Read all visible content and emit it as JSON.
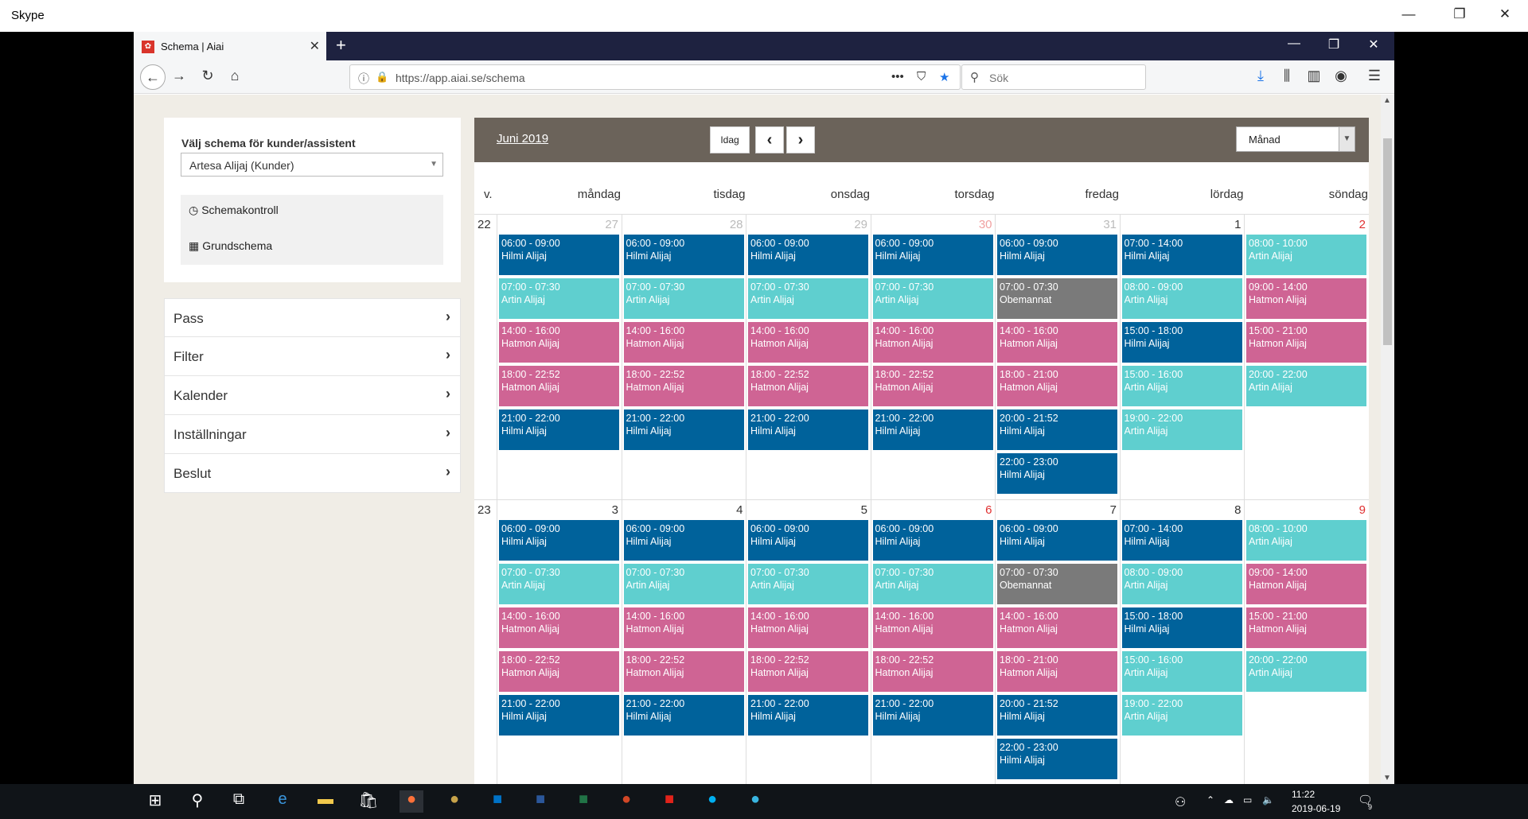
{
  "skype": {
    "title": "Skype",
    "min": "—",
    "max": "❐",
    "close": "✕"
  },
  "browser": {
    "tab_title": "Schema | Aiai",
    "tab_close": "✕",
    "new_tab": "+",
    "url": "https://app.aiai.se/schema",
    "url_actions": "•••",
    "search_placeholder": "Sök",
    "win_min": "—",
    "win_max": "❐",
    "win_close": "✕"
  },
  "left": {
    "label": "Välj schema för kunder/assistent",
    "select_value": "Artesa Alijaj (Kunder)",
    "links": [
      "Schemakontroll",
      "Grundschema"
    ],
    "accordion": [
      "Pass",
      "Filter",
      "Kalender",
      "Inställningar",
      "Beslut"
    ]
  },
  "calendar": {
    "month": "Juni 2019",
    "today": "Idag",
    "prev": "‹",
    "next": "›",
    "view": "Månad",
    "week_header": "v.",
    "days": [
      "måndag",
      "tisdag",
      "onsdag",
      "torsdag",
      "fredag",
      "lördag",
      "söndag"
    ],
    "colors": {
      "dark": "#00629b",
      "light": "#5fcfcf",
      "pink": "#cf6494",
      "gray": "#7a7a7a"
    },
    "weeks": [
      {
        "num": "22",
        "dates": [
          {
            "d": "27",
            "other": true
          },
          {
            "d": "28",
            "other": true
          },
          {
            "d": "29",
            "other": true
          },
          {
            "d": "30",
            "other": true,
            "red": true
          },
          {
            "d": "31",
            "other": true
          },
          {
            "d": "1"
          },
          {
            "d": "2",
            "red": true
          }
        ],
        "events": [
          [
            [
              "06:00 - 09:00",
              "Hilmi Alijaj",
              "dark"
            ],
            [
              "07:00 - 07:30",
              "Artin Alijaj",
              "light"
            ],
            [
              "14:00 - 16:00",
              "Hatmon Alijaj",
              "pink"
            ],
            [
              "18:00 - 22:52",
              "Hatmon Alijaj",
              "pink"
            ],
            [
              "21:00 - 22:00",
              "Hilmi Alijaj",
              "dark"
            ]
          ],
          [
            [
              "06:00 - 09:00",
              "Hilmi Alijaj",
              "dark"
            ],
            [
              "07:00 - 07:30",
              "Artin Alijaj",
              "light"
            ],
            [
              "14:00 - 16:00",
              "Hatmon Alijaj",
              "pink"
            ],
            [
              "18:00 - 22:52",
              "Hatmon Alijaj",
              "pink"
            ],
            [
              "21:00 - 22:00",
              "Hilmi Alijaj",
              "dark"
            ]
          ],
          [
            [
              "06:00 - 09:00",
              "Hilmi Alijaj",
              "dark"
            ],
            [
              "07:00 - 07:30",
              "Artin Alijaj",
              "light"
            ],
            [
              "14:00 - 16:00",
              "Hatmon Alijaj",
              "pink"
            ],
            [
              "18:00 - 22:52",
              "Hatmon Alijaj",
              "pink"
            ],
            [
              "21:00 - 22:00",
              "Hilmi Alijaj",
              "dark"
            ]
          ],
          [
            [
              "06:00 - 09:00",
              "Hilmi Alijaj",
              "dark"
            ],
            [
              "07:00 - 07:30",
              "Artin Alijaj",
              "light"
            ],
            [
              "14:00 - 16:00",
              "Hatmon Alijaj",
              "pink"
            ],
            [
              "18:00 - 22:52",
              "Hatmon Alijaj",
              "pink"
            ],
            [
              "21:00 - 22:00",
              "Hilmi Alijaj",
              "dark"
            ]
          ],
          [
            [
              "06:00 - 09:00",
              "Hilmi Alijaj",
              "dark"
            ],
            [
              "07:00 - 07:30",
              "Obemannat",
              "gray"
            ],
            [
              "14:00 - 16:00",
              "Hatmon Alijaj",
              "pink"
            ],
            [
              "18:00 - 21:00",
              "Hatmon Alijaj",
              "pink"
            ],
            [
              "20:00 - 21:52",
              "Hilmi Alijaj",
              "dark"
            ],
            [
              "22:00 - 23:00",
              "Hilmi Alijaj",
              "dark"
            ]
          ],
          [
            [
              "07:00 - 14:00",
              "Hilmi Alijaj",
              "dark"
            ],
            [
              "08:00 - 09:00",
              "Artin Alijaj",
              "light"
            ],
            [
              "15:00 - 18:00",
              "Hilmi Alijaj",
              "dark"
            ],
            [
              "15:00 - 16:00",
              "Artin Alijaj",
              "light"
            ],
            [
              "19:00 - 22:00",
              "Artin Alijaj",
              "light"
            ]
          ],
          [
            [
              "08:00 - 10:00",
              "Artin Alijaj",
              "light"
            ],
            [
              "09:00 - 14:00",
              "Hatmon Alijaj",
              "pink"
            ],
            [
              "15:00 - 21:00",
              "Hatmon Alijaj",
              "pink"
            ],
            [
              "20:00 - 22:00",
              "Artin Alijaj",
              "light"
            ]
          ]
        ]
      },
      {
        "num": "23",
        "dates": [
          {
            "d": "3"
          },
          {
            "d": "4"
          },
          {
            "d": "5"
          },
          {
            "d": "6",
            "red": true
          },
          {
            "d": "7"
          },
          {
            "d": "8"
          },
          {
            "d": "9",
            "red": true
          }
        ],
        "events": [
          [
            [
              "06:00 - 09:00",
              "Hilmi Alijaj",
              "dark"
            ],
            [
              "07:00 - 07:30",
              "Artin Alijaj",
              "light"
            ],
            [
              "14:00 - 16:00",
              "Hatmon Alijaj",
              "pink"
            ],
            [
              "18:00 - 22:52",
              "Hatmon Alijaj",
              "pink"
            ],
            [
              "21:00 - 22:00",
              "Hilmi Alijaj",
              "dark"
            ]
          ],
          [
            [
              "06:00 - 09:00",
              "Hilmi Alijaj",
              "dark"
            ],
            [
              "07:00 - 07:30",
              "Artin Alijaj",
              "light"
            ],
            [
              "14:00 - 16:00",
              "Hatmon Alijaj",
              "pink"
            ],
            [
              "18:00 - 22:52",
              "Hatmon Alijaj",
              "pink"
            ],
            [
              "21:00 - 22:00",
              "Hilmi Alijaj",
              "dark"
            ]
          ],
          [
            [
              "06:00 - 09:00",
              "Hilmi Alijaj",
              "dark"
            ],
            [
              "07:00 - 07:30",
              "Artin Alijaj",
              "light"
            ],
            [
              "14:00 - 16:00",
              "Hatmon Alijaj",
              "pink"
            ],
            [
              "18:00 - 22:52",
              "Hatmon Alijaj",
              "pink"
            ],
            [
              "21:00 - 22:00",
              "Hilmi Alijaj",
              "dark"
            ]
          ],
          [
            [
              "06:00 - 09:00",
              "Hilmi Alijaj",
              "dark"
            ],
            [
              "07:00 - 07:30",
              "Artin Alijaj",
              "light"
            ],
            [
              "14:00 - 16:00",
              "Hatmon Alijaj",
              "pink"
            ],
            [
              "18:00 - 22:52",
              "Hatmon Alijaj",
              "pink"
            ],
            [
              "21:00 - 22:00",
              "Hilmi Alijaj",
              "dark"
            ]
          ],
          [
            [
              "06:00 - 09:00",
              "Hilmi Alijaj",
              "dark"
            ],
            [
              "07:00 - 07:30",
              "Obemannat",
              "gray"
            ],
            [
              "14:00 - 16:00",
              "Hatmon Alijaj",
              "pink"
            ],
            [
              "18:00 - 21:00",
              "Hatmon Alijaj",
              "pink"
            ],
            [
              "20:00 - 21:52",
              "Hilmi Alijaj",
              "dark"
            ],
            [
              "22:00 - 23:00",
              "Hilmi Alijaj",
              "dark"
            ]
          ],
          [
            [
              "07:00 - 14:00",
              "Hilmi Alijaj",
              "dark"
            ],
            [
              "08:00 - 09:00",
              "Artin Alijaj",
              "light"
            ],
            [
              "15:00 - 18:00",
              "Hilmi Alijaj",
              "dark"
            ],
            [
              "15:00 - 16:00",
              "Artin Alijaj",
              "light"
            ],
            [
              "19:00 - 22:00",
              "Artin Alijaj",
              "light"
            ]
          ],
          [
            [
              "08:00 - 10:00",
              "Artin Alijaj",
              "light"
            ],
            [
              "09:00 - 14:00",
              "Hatmon Alijaj",
              "pink"
            ],
            [
              "15:00 - 21:00",
              "Hatmon Alijaj",
              "pink"
            ],
            [
              "20:00 - 22:00",
              "Artin Alijaj",
              "light"
            ]
          ]
        ]
      }
    ]
  },
  "taskbar": {
    "time": "11:22",
    "date": "2019-06-19",
    "notif_count": "9"
  }
}
